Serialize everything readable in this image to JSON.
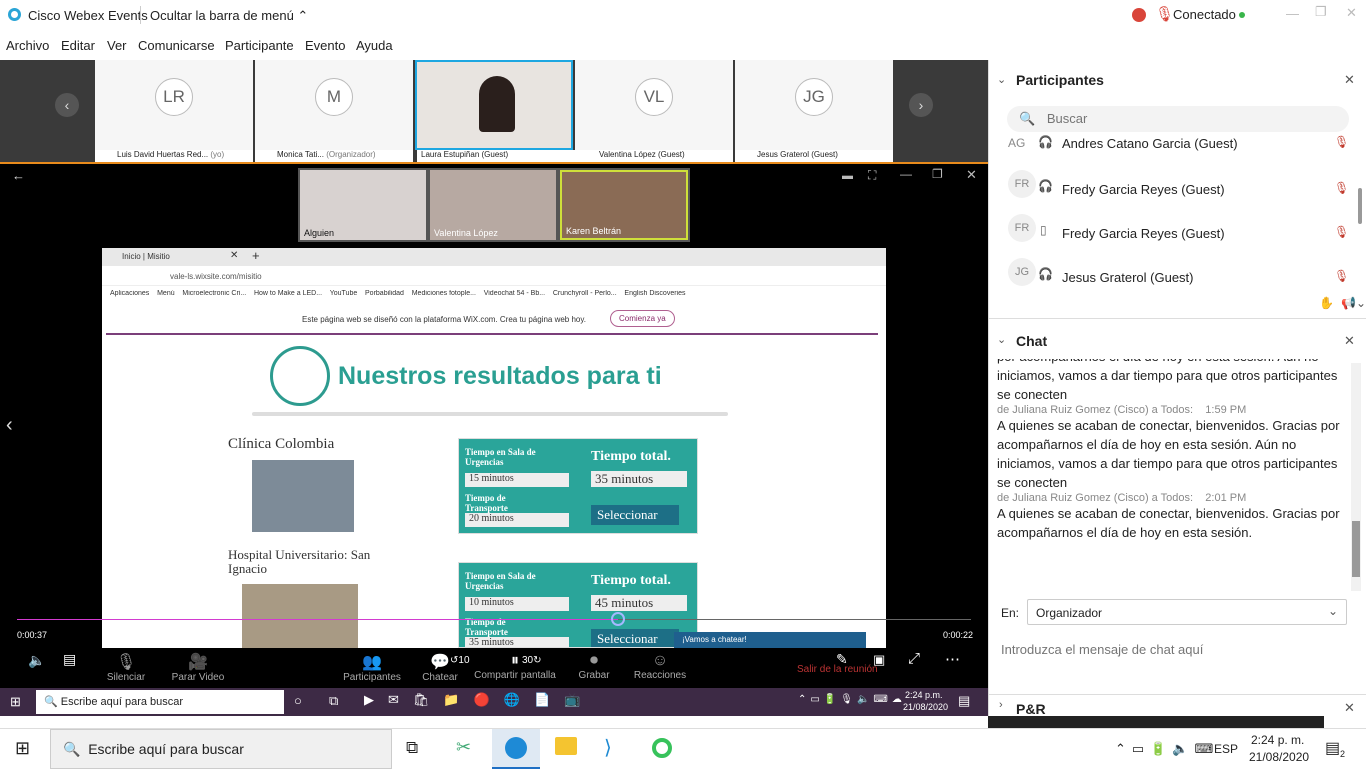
{
  "window": {
    "title": "Cisco Webex Events",
    "hide_menu_label": "Ocultar la barra de menú",
    "status": "Conectado"
  },
  "menu": [
    "Archivo",
    "Editar",
    "Ver",
    "Comunicarse",
    "Participante",
    "Evento",
    "Ayuda"
  ],
  "thumbnails": [
    {
      "initials": "LR",
      "name": "Luis David Huertas Red...",
      "role": "(yo)"
    },
    {
      "initials": "M",
      "name": "Monica Tati...",
      "role": "(Organizador)"
    },
    {
      "initials": "",
      "name": "Laura Estupiñan (Guest)",
      "role": ""
    },
    {
      "initials": "VL",
      "name": "Valentina López (Guest)",
      "role": ""
    },
    {
      "initials": "JG",
      "name": "Jesus Graterol (Guest)",
      "role": ""
    }
  ],
  "gallery": [
    "Alguien",
    "Valentina López",
    "Karen Beltrán"
  ],
  "browser": {
    "tab": "Inicio | Misitio",
    "url": "vale-ls.wixsite.com/misitio",
    "bookmarks": [
      "Aplicaciones",
      "Menú",
      "Microelectronic Cri...",
      "How to Make a LED...",
      "YouTube",
      "Porbabilidad",
      "Mediciones fotople...",
      "Videochat 54 - Bb...",
      "Crunchyroll - Perlo...",
      "English Discoveries"
    ],
    "wix_banner": "Este página web se diseñó con la plataforma WiX.com. Crea tu página web hoy.",
    "wix_button": "Comienza ya"
  },
  "site": {
    "heading": "Nuestros resultados para ti",
    "results": [
      {
        "name": "Clínica Colombia",
        "urg_label": "Tiempo en Sala de Urgencias",
        "urg": "15 minutos",
        "trans_label": "Tiempo de Transporte",
        "trans": "20 minutos",
        "total_label": "Tiempo total.",
        "total": "35 minutos",
        "select": "Seleccionar"
      },
      {
        "name": "Hospital Universitario: San Ignacio",
        "urg_label": "Tiempo en Sala de Urgencias",
        "urg": "10 minutos",
        "trans_label": "Tiempo de Transporte",
        "trans": "35 minutos",
        "total_label": "Tiempo total.",
        "total": "45 minutos",
        "select": "Seleccionar"
      }
    ],
    "chat_popup": "¡Vamos a chatear!"
  },
  "player": {
    "elapsed": "0:00:37",
    "remaining": "0:00:22",
    "progress": 0.63
  },
  "controls": [
    "Silenciar",
    "Parar Video",
    "Participantes",
    "Chatear",
    "Compartir pantalla",
    "Grabar",
    "Reacciones"
  ],
  "leave_label": "Salir de la reunión",
  "inner_taskbar": {
    "search": "Escribe aquí para buscar",
    "time": "2:24 p.m.",
    "date": "21/08/2020"
  },
  "participants_panel": {
    "title": "Participantes",
    "search_placeholder": "Buscar",
    "rows": [
      {
        "initials": "AG",
        "name": "Andres Catano Garcia (Guest)"
      },
      {
        "initials": "FR",
        "name": "Fredy Garcia Reyes (Guest)"
      },
      {
        "initials": "FR",
        "name": "Fredy Garcia Reyes (Guest)"
      },
      {
        "initials": "JG",
        "name": "Jesus Graterol (Guest)"
      }
    ]
  },
  "chat_panel": {
    "title": "Chat",
    "messages": [
      {
        "meta": "",
        "text": "por acompañarnos el día de hoy en esta sesión. Aún no iniciamos, vamos a dar tiempo para que otros participantes se conecten"
      },
      {
        "meta": "de Juliana Ruiz Gomez (Cisco) a Todos:    1:59 PM",
        "text": "A quienes se acaban de conectar, bienvenidos. Gracias por acompañarnos el día de hoy en esta sesión. Aún no iniciamos, vamos a dar tiempo para que otros participantes se conecten"
      },
      {
        "meta": "de Juliana Ruiz Gomez (Cisco) a Todos:    2:01 PM",
        "text": "A quienes se acaban de conectar, bienvenidos. Gracias por acompañarnos el día de hoy en esta sesión."
      }
    ],
    "to_label": "En:",
    "to_value": "Organizador",
    "input_placeholder": "Introduzca el mensaje de chat aquí"
  },
  "qa_label": "P&R",
  "taskbar": {
    "search": "Escribe aquí para buscar",
    "lang": "ESP",
    "time": "2:24 p. m.",
    "date": "21/08/2020",
    "notif": "2"
  }
}
